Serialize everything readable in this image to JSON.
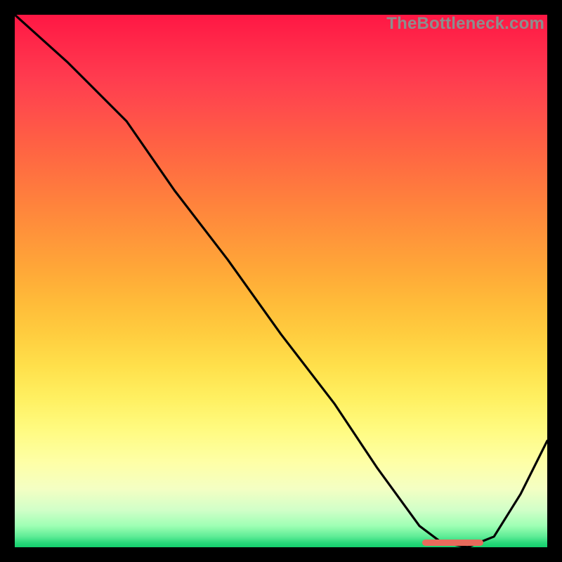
{
  "watermark": "TheBottleneck.com",
  "chart_data": {
    "type": "line",
    "title": "",
    "xlabel": "",
    "ylabel": "",
    "xlim": [
      0,
      100
    ],
    "ylim": [
      0,
      100
    ],
    "grid": false,
    "series": [
      {
        "name": "bottleneck-curve",
        "color": "#000000",
        "x": [
          0,
          10,
          21,
          30,
          40,
          50,
          60,
          68,
          76,
          80,
          85,
          90,
          95,
          100
        ],
        "y": [
          100,
          91,
          80,
          67,
          54,
          40,
          27,
          15,
          4,
          1,
          0,
          2,
          10,
          20
        ]
      }
    ],
    "annotations": [
      {
        "name": "optimal-range-marker",
        "type": "segment",
        "color": "#e86b5c",
        "x0": 76.5,
        "x1": 88.0,
        "y": 0.8
      }
    ],
    "background_gradient": {
      "top": "#ff1744",
      "mid": "#ffe04b",
      "bottom": "#14cf6d"
    }
  }
}
